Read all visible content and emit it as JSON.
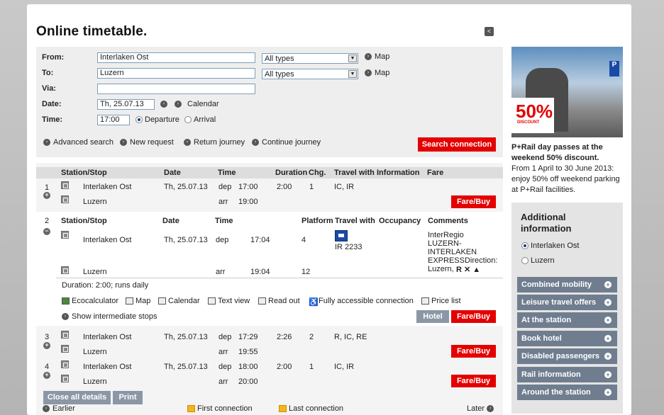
{
  "title": "Online timetable.",
  "form": {
    "from_label": "From:",
    "from_value": "Interlaken Ost",
    "from_type": "All types",
    "to_label": "To:",
    "to_value": "Luzern",
    "to_type": "All types",
    "via_label": "Via:",
    "via_value": "",
    "date_label": "Date:",
    "date_value": "Th, 25.07.13",
    "calendar": "Calendar",
    "time_label": "Time:",
    "time_value": "17:00",
    "departure": "Departure",
    "arrival": "Arrival",
    "map": "Map",
    "advanced": "Advanced search",
    "new_request": "New request",
    "return": "Return journey",
    "continue": "Continue journey",
    "search": "Search connection"
  },
  "results": {
    "headers": [
      "Station/Stop",
      "Date",
      "Time",
      "Duration",
      "Chg.",
      "Travel with",
      "Information",
      "Fare"
    ],
    "headers2": [
      "Station/Stop",
      "Date",
      "Time",
      "Platform",
      "Travel with",
      "Occupancy",
      "Comments"
    ],
    "fare_buy": "Fare/Buy",
    "hotel": "Hotel",
    "conn1": {
      "num": "1",
      "from": "Interlaken Ost",
      "to": "Luzern",
      "date": "Th, 25.07.13",
      "dep": "dep",
      "dep_t": "17:00",
      "arr": "arr",
      "arr_t": "19:00",
      "dur": "2:00",
      "chg": "1",
      "with": "IC, IR"
    },
    "conn2": {
      "num": "2",
      "from": "Interlaken Ost",
      "to": "Luzern",
      "date": "Th, 25.07.13",
      "dep": "dep",
      "dep_t": "17:04",
      "arr": "arr",
      "arr_t": "19:04",
      "plat1": "4",
      "plat2": "12",
      "train": "IR 2233",
      "comments": [
        "InterRegio",
        "LUZERN-",
        "INTERLAKEN",
        "EXPRESSDirection:",
        "Luzern,"
      ],
      "comment_marks": "R ✕ ▲",
      "duration_text": "Duration: 2:00; runs daily"
    },
    "tools": [
      "Ecocalculator",
      "Map",
      "Calendar",
      "Text view",
      "Read out",
      "Fully accessible connection",
      "Price list"
    ],
    "intermediate": "Show intermediate stops",
    "conn3": {
      "num": "3",
      "from": "Interlaken Ost",
      "to": "Luzern",
      "date": "Th, 25.07.13",
      "dep": "dep",
      "dep_t": "17:29",
      "arr": "arr",
      "arr_t": "19:55",
      "dur": "2:26",
      "chg": "2",
      "with": "R, IC, RE"
    },
    "conn4": {
      "num": "4",
      "from": "Interlaken Ost",
      "to": "Luzern",
      "date": "Th, 25.07.13",
      "dep": "dep",
      "dep_t": "18:00",
      "arr": "arr",
      "arr_t": "20:00",
      "dur": "2:00",
      "chg": "1",
      "with": "IC, IR"
    },
    "close_all": "Close all details",
    "print": "Print",
    "earlier": "Earlier",
    "first": "First connection",
    "last": "Last connection",
    "later": "Later"
  },
  "ad": {
    "percent": "50%",
    "discount": "DISCOUNT",
    "headline": "P+Rail day passes at the weekend 50% discount.",
    "body": "From 1 April to 30 June 2013: enjoy 50% off weekend parking at P+Rail facilities."
  },
  "info": {
    "title": "Additional information",
    "options": [
      "Interlaken Ost",
      "Luzern"
    ],
    "buttons": [
      "Combined mobility",
      "Leisure travel offers",
      "At the station",
      "Book hotel",
      "Disabled passengers",
      "Rail information",
      "Around the station"
    ]
  }
}
